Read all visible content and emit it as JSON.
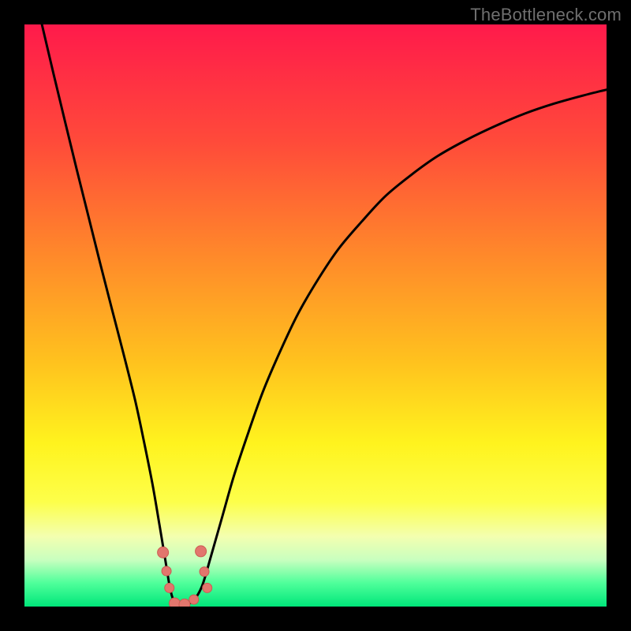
{
  "watermark": "TheBottleneck.com",
  "colors": {
    "frame": "#000000",
    "curve": "#000000",
    "marker_fill": "#e2766d",
    "marker_stroke": "#cc5b52",
    "gradient_stops": [
      {
        "offset": 0.0,
        "color": "#ff1a4b"
      },
      {
        "offset": 0.2,
        "color": "#ff4a3a"
      },
      {
        "offset": 0.4,
        "color": "#ff8a2a"
      },
      {
        "offset": 0.58,
        "color": "#ffc21e"
      },
      {
        "offset": 0.72,
        "color": "#fff31e"
      },
      {
        "offset": 0.82,
        "color": "#fdff4a"
      },
      {
        "offset": 0.88,
        "color": "#f3ffb0"
      },
      {
        "offset": 0.92,
        "color": "#c8ffbf"
      },
      {
        "offset": 0.96,
        "color": "#4eff9a"
      },
      {
        "offset": 1.0,
        "color": "#00e67a"
      }
    ]
  },
  "chart_data": {
    "type": "line",
    "title": "",
    "xlabel": "",
    "ylabel": "",
    "xlim": [
      0,
      100
    ],
    "ylim": [
      0,
      100
    ],
    "x": [
      3,
      5,
      7,
      9,
      11,
      13,
      15,
      17,
      19,
      20.5,
      22,
      23.2,
      24.2,
      25,
      25.7,
      26.3,
      27.5,
      29,
      30.5,
      32,
      34,
      36,
      38.5,
      41,
      44,
      47,
      50.5,
      54,
      58,
      62,
      66.5,
      71,
      76,
      81,
      86,
      91,
      96,
      100
    ],
    "values": [
      100,
      91.5,
      83.2,
      75,
      67,
      59,
      51.2,
      43.5,
      35.5,
      28.5,
      21,
      14,
      8,
      3.2,
      0.8,
      0.3,
      0.3,
      1.0,
      3.5,
      8.5,
      15.5,
      22.5,
      30,
      37,
      44,
      50.3,
      56.3,
      61.5,
      66.2,
      70.5,
      74.2,
      77.4,
      80.2,
      82.6,
      84.7,
      86.4,
      87.8,
      88.8
    ],
    "markers": [
      {
        "x": 23.8,
        "y": 9.3,
        "r": 7
      },
      {
        "x": 24.4,
        "y": 6.1,
        "r": 6
      },
      {
        "x": 24.9,
        "y": 3.2,
        "r": 6
      },
      {
        "x": 25.8,
        "y": 0.55,
        "r": 7
      },
      {
        "x": 27.5,
        "y": 0.35,
        "r": 7
      },
      {
        "x": 29.1,
        "y": 1.2,
        "r": 6
      },
      {
        "x": 30.3,
        "y": 9.5,
        "r": 7
      },
      {
        "x": 30.9,
        "y": 6.0,
        "r": 6
      },
      {
        "x": 31.4,
        "y": 3.2,
        "r": 6
      }
    ]
  }
}
